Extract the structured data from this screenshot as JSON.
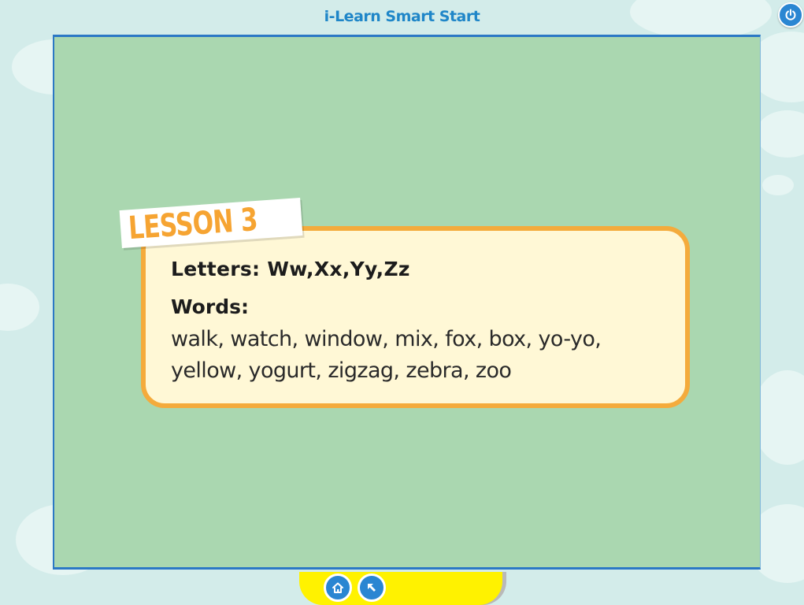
{
  "header": {
    "title": "i-Learn Smart Start"
  },
  "lesson": {
    "tag": "LESSON 3",
    "letters_line": "Letters: Ww,Xx,Yy,Zz",
    "words_heading": "Words:",
    "words_line_1": "walk, watch, window, mix, fox, box, yo-yo,",
    "words_line_2": "yellow, yogurt, zigzag, zebra, zoo"
  },
  "nav": {
    "home_icon": "home-icon",
    "back_icon": "back-arrow-icon",
    "power_icon": "power-icon"
  },
  "colors": {
    "background": "#d3ecea",
    "stage": "#aad7b0",
    "card_fill": "#fff8d6",
    "card_border": "#f4ab3c",
    "accent_blue": "#2a86d2",
    "bottom_bar": "#fff200"
  }
}
